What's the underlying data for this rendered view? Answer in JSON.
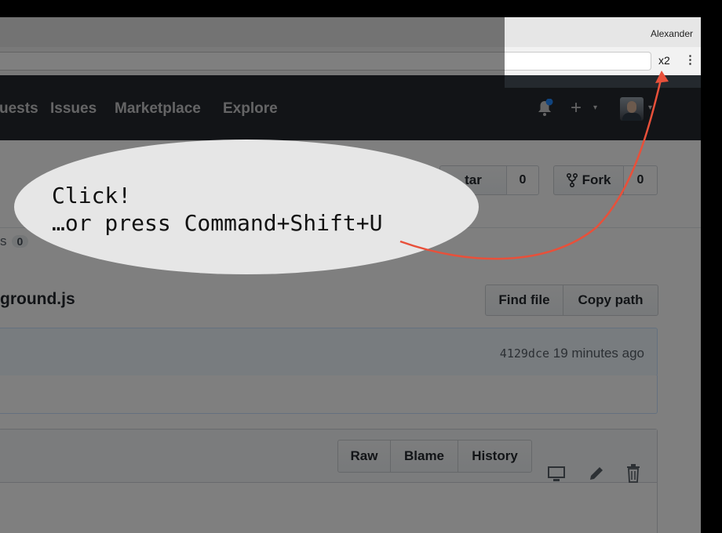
{
  "browser": {
    "profile_name": "Alexander",
    "extension_badge": "x2",
    "menu_glyph": "⋮"
  },
  "nav": {
    "pull_requests": "uests",
    "issues": "Issues",
    "marketplace": "Marketplace",
    "explore": "Explore",
    "plus_glyph": "+",
    "caret_glyph": "▾"
  },
  "repo": {
    "star_label": "tar",
    "star_count": "0",
    "fork_label": "Fork",
    "fork_count": "0",
    "tab_fragment": "s",
    "tab_count": "0"
  },
  "file": {
    "path_fragment": "ground.js",
    "find_file": "Find file",
    "copy_path": "Copy path",
    "commit_sha": "4129dce",
    "commit_time": "19 minutes ago",
    "raw": "Raw",
    "blame": "Blame",
    "history": "History"
  },
  "overlay": {
    "line1": "Click!",
    "line2": "…or press Command+Shift+U",
    "arrow_color": "#e8503a"
  }
}
